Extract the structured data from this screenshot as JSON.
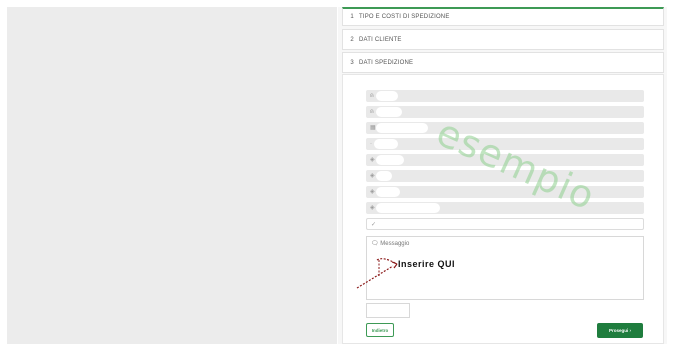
{
  "sections": [
    {
      "number": "1",
      "title": "TIPO E COSTI DI SPEDIZIONE"
    },
    {
      "number": "2",
      "title": "DATI CLIENTE"
    },
    {
      "number": "3",
      "title": "DATI SPEDIZIONE"
    }
  ],
  "form": {
    "message_placeholder": "Messaggio",
    "note": "Inserire  QUI",
    "back_button": "Indietro",
    "next_button": "Prosegui"
  },
  "watermark": "esempio",
  "icons": {
    "field_icons": [
      "user-icon",
      "user-icon",
      "building-icon",
      "location-icon",
      "location-icon",
      "location-icon",
      "location-icon",
      "phone-icon",
      "email-icon"
    ],
    "message_icon": "message-icon",
    "next_icon": "chevron-right-icon"
  },
  "colors": {
    "accent": "#1f7d3e",
    "accent_light": "#3d9a55",
    "watermark": "#8fd08f",
    "arrow": "#8b1a1a"
  }
}
